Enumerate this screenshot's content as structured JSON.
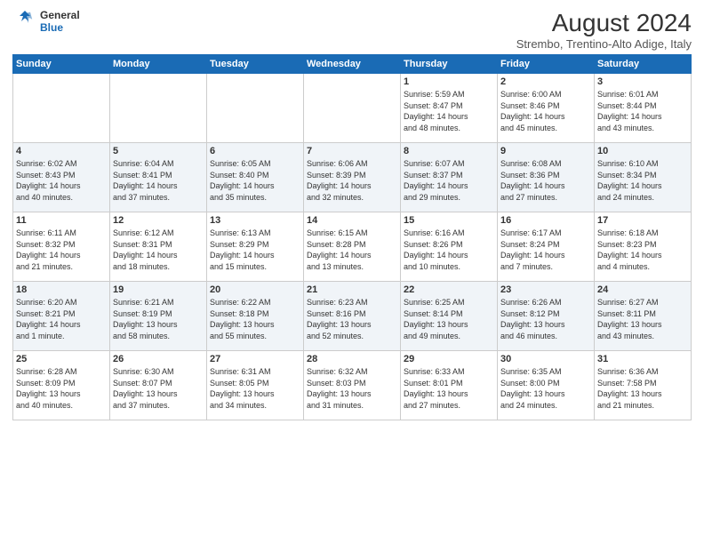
{
  "logo": {
    "line1": "General",
    "line2": "Blue"
  },
  "title": "August 2024",
  "location": "Strembo, Trentino-Alto Adige, Italy",
  "days_of_week": [
    "Sunday",
    "Monday",
    "Tuesday",
    "Wednesday",
    "Thursday",
    "Friday",
    "Saturday"
  ],
  "weeks": [
    [
      {
        "day": "",
        "content": ""
      },
      {
        "day": "",
        "content": ""
      },
      {
        "day": "",
        "content": ""
      },
      {
        "day": "",
        "content": ""
      },
      {
        "day": "1",
        "content": "Sunrise: 5:59 AM\nSunset: 8:47 PM\nDaylight: 14 hours\nand 48 minutes."
      },
      {
        "day": "2",
        "content": "Sunrise: 6:00 AM\nSunset: 8:46 PM\nDaylight: 14 hours\nand 45 minutes."
      },
      {
        "day": "3",
        "content": "Sunrise: 6:01 AM\nSunset: 8:44 PM\nDaylight: 14 hours\nand 43 minutes."
      }
    ],
    [
      {
        "day": "4",
        "content": "Sunrise: 6:02 AM\nSunset: 8:43 PM\nDaylight: 14 hours\nand 40 minutes."
      },
      {
        "day": "5",
        "content": "Sunrise: 6:04 AM\nSunset: 8:41 PM\nDaylight: 14 hours\nand 37 minutes."
      },
      {
        "day": "6",
        "content": "Sunrise: 6:05 AM\nSunset: 8:40 PM\nDaylight: 14 hours\nand 35 minutes."
      },
      {
        "day": "7",
        "content": "Sunrise: 6:06 AM\nSunset: 8:39 PM\nDaylight: 14 hours\nand 32 minutes."
      },
      {
        "day": "8",
        "content": "Sunrise: 6:07 AM\nSunset: 8:37 PM\nDaylight: 14 hours\nand 29 minutes."
      },
      {
        "day": "9",
        "content": "Sunrise: 6:08 AM\nSunset: 8:36 PM\nDaylight: 14 hours\nand 27 minutes."
      },
      {
        "day": "10",
        "content": "Sunrise: 6:10 AM\nSunset: 8:34 PM\nDaylight: 14 hours\nand 24 minutes."
      }
    ],
    [
      {
        "day": "11",
        "content": "Sunrise: 6:11 AM\nSunset: 8:32 PM\nDaylight: 14 hours\nand 21 minutes."
      },
      {
        "day": "12",
        "content": "Sunrise: 6:12 AM\nSunset: 8:31 PM\nDaylight: 14 hours\nand 18 minutes."
      },
      {
        "day": "13",
        "content": "Sunrise: 6:13 AM\nSunset: 8:29 PM\nDaylight: 14 hours\nand 15 minutes."
      },
      {
        "day": "14",
        "content": "Sunrise: 6:15 AM\nSunset: 8:28 PM\nDaylight: 14 hours\nand 13 minutes."
      },
      {
        "day": "15",
        "content": "Sunrise: 6:16 AM\nSunset: 8:26 PM\nDaylight: 14 hours\nand 10 minutes."
      },
      {
        "day": "16",
        "content": "Sunrise: 6:17 AM\nSunset: 8:24 PM\nDaylight: 14 hours\nand 7 minutes."
      },
      {
        "day": "17",
        "content": "Sunrise: 6:18 AM\nSunset: 8:23 PM\nDaylight: 14 hours\nand 4 minutes."
      }
    ],
    [
      {
        "day": "18",
        "content": "Sunrise: 6:20 AM\nSunset: 8:21 PM\nDaylight: 14 hours\nand 1 minute."
      },
      {
        "day": "19",
        "content": "Sunrise: 6:21 AM\nSunset: 8:19 PM\nDaylight: 13 hours\nand 58 minutes."
      },
      {
        "day": "20",
        "content": "Sunrise: 6:22 AM\nSunset: 8:18 PM\nDaylight: 13 hours\nand 55 minutes."
      },
      {
        "day": "21",
        "content": "Sunrise: 6:23 AM\nSunset: 8:16 PM\nDaylight: 13 hours\nand 52 minutes."
      },
      {
        "day": "22",
        "content": "Sunrise: 6:25 AM\nSunset: 8:14 PM\nDaylight: 13 hours\nand 49 minutes."
      },
      {
        "day": "23",
        "content": "Sunrise: 6:26 AM\nSunset: 8:12 PM\nDaylight: 13 hours\nand 46 minutes."
      },
      {
        "day": "24",
        "content": "Sunrise: 6:27 AM\nSunset: 8:11 PM\nDaylight: 13 hours\nand 43 minutes."
      }
    ],
    [
      {
        "day": "25",
        "content": "Sunrise: 6:28 AM\nSunset: 8:09 PM\nDaylight: 13 hours\nand 40 minutes."
      },
      {
        "day": "26",
        "content": "Sunrise: 6:30 AM\nSunset: 8:07 PM\nDaylight: 13 hours\nand 37 minutes."
      },
      {
        "day": "27",
        "content": "Sunrise: 6:31 AM\nSunset: 8:05 PM\nDaylight: 13 hours\nand 34 minutes."
      },
      {
        "day": "28",
        "content": "Sunrise: 6:32 AM\nSunset: 8:03 PM\nDaylight: 13 hours\nand 31 minutes."
      },
      {
        "day": "29",
        "content": "Sunrise: 6:33 AM\nSunset: 8:01 PM\nDaylight: 13 hours\nand 27 minutes."
      },
      {
        "day": "30",
        "content": "Sunrise: 6:35 AM\nSunset: 8:00 PM\nDaylight: 13 hours\nand 24 minutes."
      },
      {
        "day": "31",
        "content": "Sunrise: 6:36 AM\nSunset: 7:58 PM\nDaylight: 13 hours\nand 21 minutes."
      }
    ]
  ]
}
